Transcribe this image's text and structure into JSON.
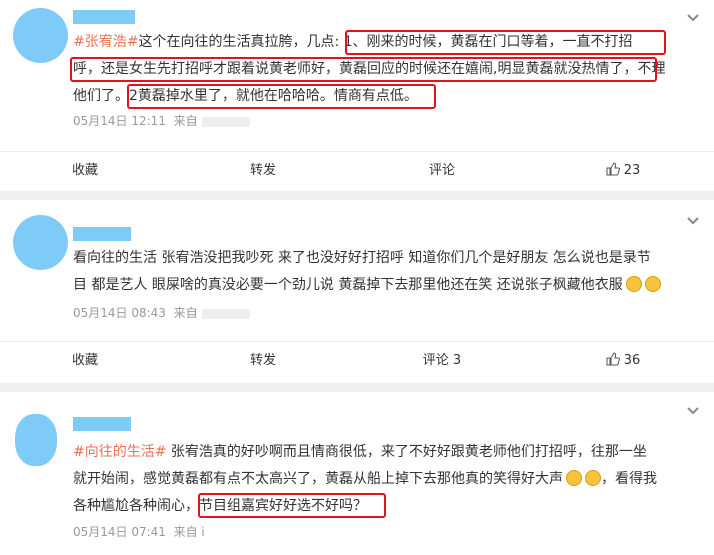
{
  "posts": [
    {
      "lines": [
        {
          "tag": "#张宥浩#",
          "text": "这个在向往的生活真拉胯，几点: 1、刚来的时候，黄磊在门口等着，一直不打招"
        },
        {
          "tag": "",
          "text": "呼，还是女生先打招呼才跟着说黄老师好，黄磊回应的时候还在嬉闹,明显黄磊就没热情了，不理"
        },
        {
          "tag": "",
          "text": "他们了。2黄磊掉水里了，就他在哈哈哈。情商有点低。"
        }
      ],
      "time": "05月14日 12:11",
      "source_prefix": "来自",
      "actions": {
        "collect": "收藏",
        "repost": "转发",
        "comment": "评论",
        "like": "23"
      }
    },
    {
      "lines": [
        {
          "tag": "",
          "text": "看向往的生活 张宥浩没把我吵死 来了也没好好打招呼 知道你们几个是好朋友 怎么说也是录节"
        },
        {
          "tag": "",
          "text": "目 都是艺人 眼屎啥的真没必要一个劲儿说 黄磊掉下去那里他还在笑 还说张子枫藏他衣服"
        }
      ],
      "time": "05月14日 08:43",
      "source_prefix": "来自",
      "actions": {
        "collect": "收藏",
        "repost": "转发",
        "comment": "评论 3",
        "like": "36"
      }
    },
    {
      "lines": [
        {
          "tag": "#向往的生活#",
          "text": " 张宥浩真的好吵啊而且情商很低，来了不好好跟黄老师他们打招呼，往那一坐"
        },
        {
          "tag": "",
          "text": "就开始闹，感觉黄磊都有点不太高兴了，黄磊从船上掉下去那他真的笑得好大声"
        },
        {
          "tag": "",
          "text": "，看得我"
        },
        {
          "tag": "",
          "text": "各种尴尬各种闹心，节目组嘉宾好好选不好吗？"
        }
      ],
      "time": "05月14日 07:41",
      "source_prefix": "来自 i"
    }
  ],
  "icons": {
    "chevron": "chevron-down-icon",
    "like": "thumb-up-icon",
    "emoji": "smile-emoji-icon"
  },
  "colors": {
    "topic": "#eb7350",
    "highlight_box": "#e0141b",
    "avatar": "#7fcbf7"
  }
}
